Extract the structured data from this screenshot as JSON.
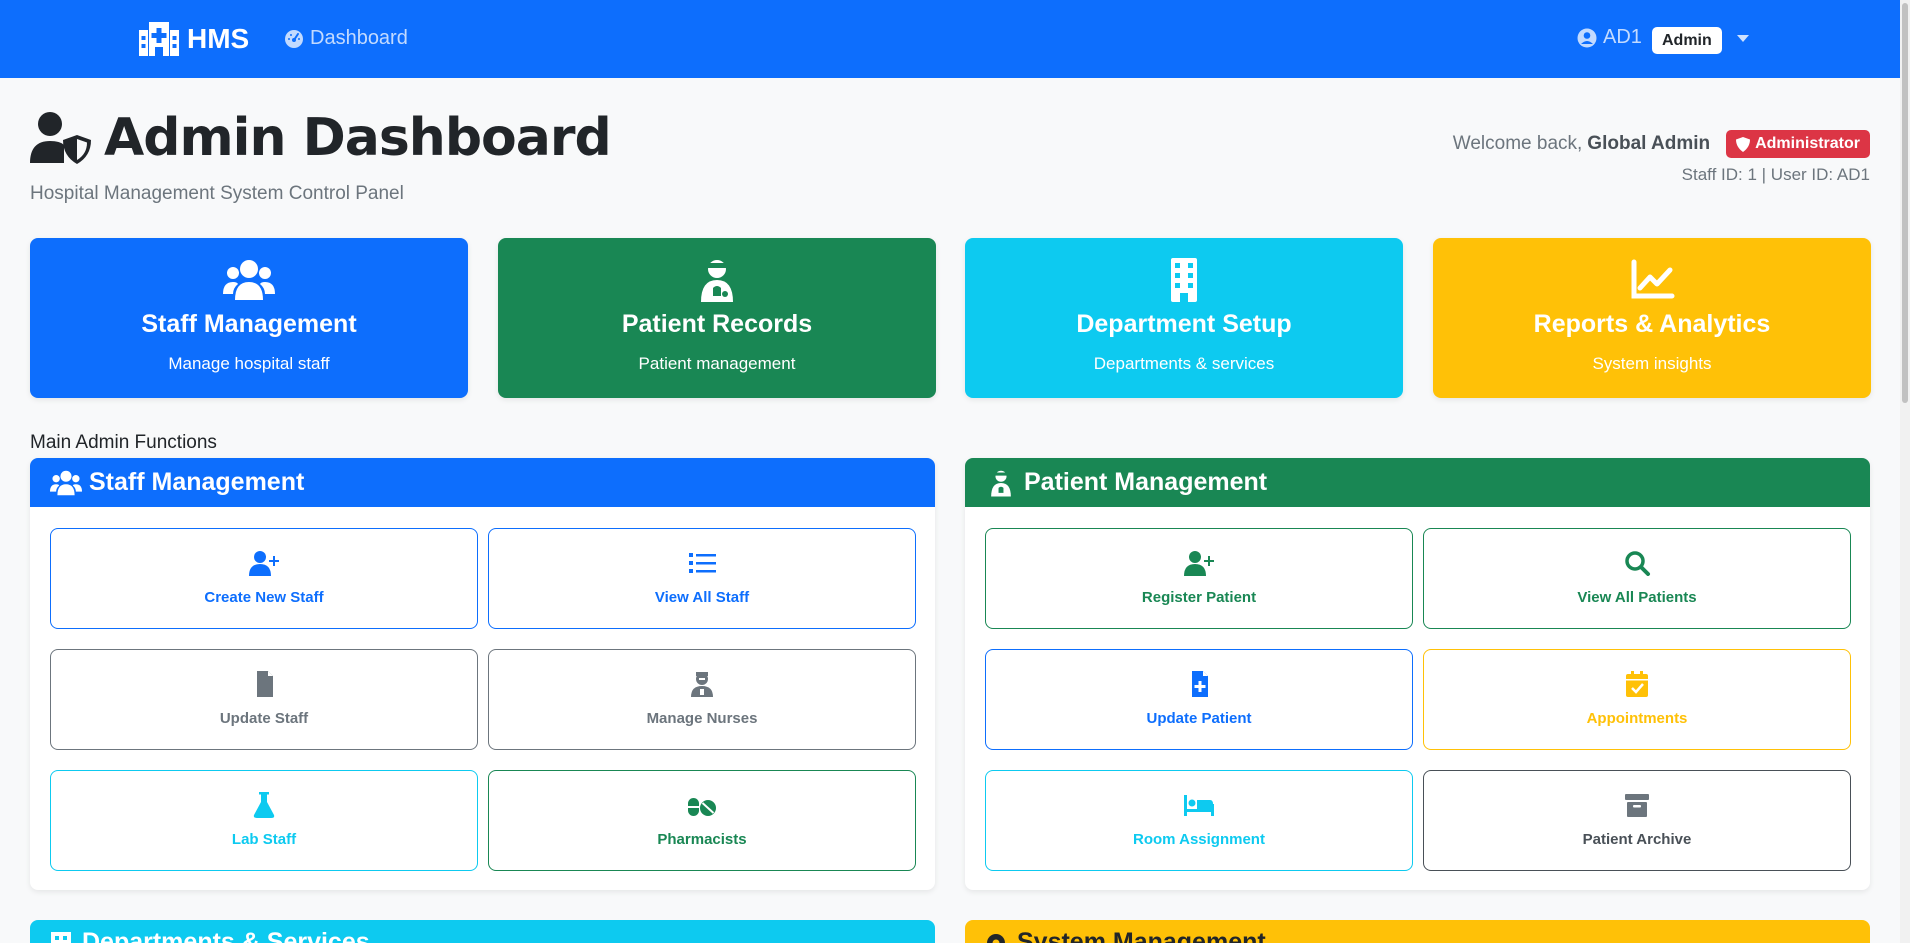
{
  "nav": {
    "brand": "HMS",
    "dashboard_link": "Dashboard",
    "user_id": "AD1",
    "role_badge": "Admin"
  },
  "header": {
    "title": "Admin Dashboard",
    "subtitle": "Hospital Management System Control Panel",
    "welcome_prefix": "Welcome back,",
    "welcome_name": "Global Admin",
    "role": "Administrator",
    "ids": "Staff ID: 1 | User ID: AD1"
  },
  "stat_cards": [
    {
      "title": "Staff Management",
      "subtitle": "Manage hospital staff",
      "icon": "users-icon",
      "color": "#0d6efd"
    },
    {
      "title": "Patient Records",
      "subtitle": "Patient management",
      "icon": "patient-icon",
      "color": "#198754"
    },
    {
      "title": "Department Setup",
      "subtitle": "Departments & services",
      "icon": "building-icon",
      "color": "#0dcaf0"
    },
    {
      "title": "Reports & Analytics",
      "subtitle": "System insights",
      "icon": "chart-line-icon",
      "color": "#ffc107"
    }
  ],
  "section_label": "Main Admin Functions",
  "staff_panel": {
    "title": "Staff Management",
    "color": "#0d6efd",
    "buttons": [
      {
        "label": "Create New Staff",
        "icon": "user-plus-icon",
        "color": "#0d6efd"
      },
      {
        "label": "View All Staff",
        "icon": "list-icon",
        "color": "#0d6efd"
      },
      {
        "label": "Update Staff",
        "icon": "file-icon",
        "color": "#6c757d"
      },
      {
        "label": "Manage Nurses",
        "icon": "nurse-icon",
        "color": "#6c757d"
      },
      {
        "label": "Lab Staff",
        "icon": "flask-icon",
        "color": "#0dcaf0"
      },
      {
        "label": "Pharmacists",
        "icon": "pills-icon",
        "color": "#198754"
      }
    ]
  },
  "patient_panel": {
    "title": "Patient Management",
    "color": "#198754",
    "buttons": [
      {
        "label": "Register Patient",
        "icon": "user-plus-icon",
        "color": "#198754"
      },
      {
        "label": "View All Patients",
        "icon": "search-icon",
        "color": "#198754"
      },
      {
        "label": "Update Patient",
        "icon": "file-medical-icon",
        "color": "#0d6efd"
      },
      {
        "label": "Appointments",
        "icon": "calendar-check-icon",
        "color": "#ffc107"
      },
      {
        "label": "Room Assignment",
        "icon": "bed-icon",
        "color": "#0dcaf0"
      },
      {
        "label": "Patient Archive",
        "icon": "archive-icon",
        "color": "#6c757d"
      }
    ]
  },
  "bottom_panels": [
    {
      "title": "Departments & Services",
      "color": "#0dcaf0"
    },
    {
      "title": "System Management",
      "color": "#ffc107"
    }
  ]
}
